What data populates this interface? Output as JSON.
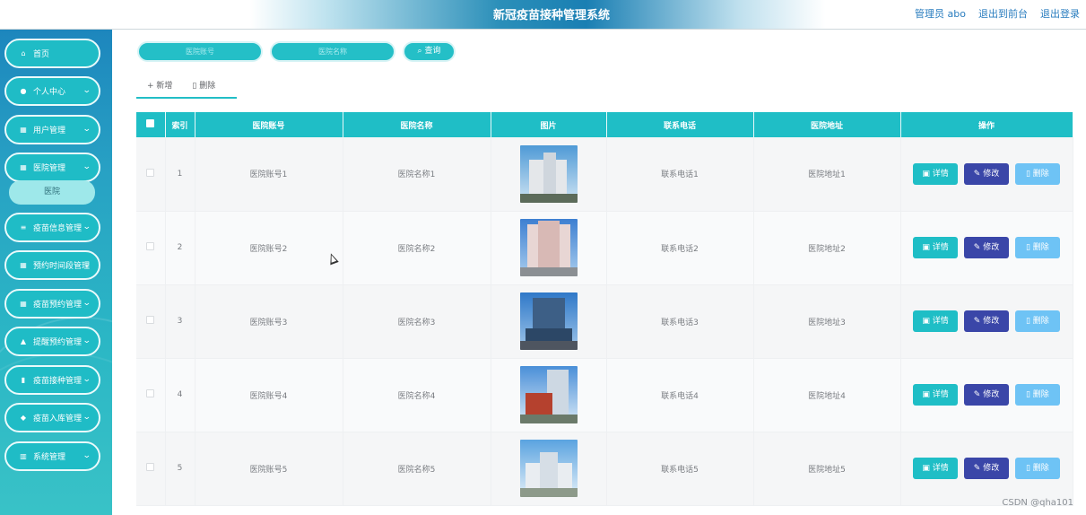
{
  "header": {
    "title": "新冠疫苗接种管理系统",
    "user": "管理员 abo",
    "back_front": "退出到前台",
    "logout": "退出登录"
  },
  "sidebar": {
    "items": [
      {
        "label": "首页",
        "icon": "home-icon",
        "expandable": false
      },
      {
        "label": "个人中心",
        "icon": "user-icon",
        "expandable": true
      },
      {
        "label": "用户管理",
        "icon": "grid-icon",
        "expandable": true
      },
      {
        "label": "医院管理",
        "icon": "grid-icon",
        "expandable": true
      },
      {
        "label": "疫苗信息管理",
        "icon": "list-icon",
        "expandable": true
      },
      {
        "label": "预约时间段管理",
        "icon": "grid-icon",
        "expandable": true
      },
      {
        "label": "疫苗预约管理",
        "icon": "grid-icon",
        "expandable": true
      },
      {
        "label": "提醒预约管理",
        "icon": "thumb-icon",
        "expandable": true
      },
      {
        "label": "疫苗接种管理",
        "icon": "clipboard-icon",
        "expandable": true
      },
      {
        "label": "疫苗入库管理",
        "icon": "location-icon",
        "expandable": true
      },
      {
        "label": "系统管理",
        "icon": "chart-icon",
        "expandable": true
      }
    ],
    "sub_item": "医院"
  },
  "search": {
    "account_placeholder": "医院账号",
    "name_placeholder": "医院名称",
    "button": "查询"
  },
  "toolbar": {
    "add": "新增",
    "delete": "删除"
  },
  "table": {
    "headers": [
      "索引",
      "医院账号",
      "医院名称",
      "图片",
      "联系电话",
      "医院地址",
      "操作"
    ],
    "rows": [
      {
        "index": "1",
        "account": "医院账号1",
        "name": "医院名称1",
        "phone": "联系电话1",
        "address": "医院地址1"
      },
      {
        "index": "2",
        "account": "医院账号2",
        "name": "医院名称2",
        "phone": "联系电话2",
        "address": "医院地址2"
      },
      {
        "index": "3",
        "account": "医院账号3",
        "name": "医院名称3",
        "phone": "联系电话3",
        "address": "医院地址3"
      },
      {
        "index": "4",
        "account": "医院账号4",
        "name": "医院名称4",
        "phone": "联系电话4",
        "address": "医院地址4"
      },
      {
        "index": "5",
        "account": "医院账号5",
        "name": "医院名称5",
        "phone": "联系电话5",
        "address": "医院地址5"
      }
    ],
    "actions": {
      "detail": "详情",
      "edit": "修改",
      "delete": "删除"
    }
  },
  "watermark": "CSDN @qha101",
  "colors": {
    "accent": "#1fbec6",
    "edit": "#3a46a8",
    "delete": "#6ec3f5",
    "sidebar": "#1d86bd"
  }
}
